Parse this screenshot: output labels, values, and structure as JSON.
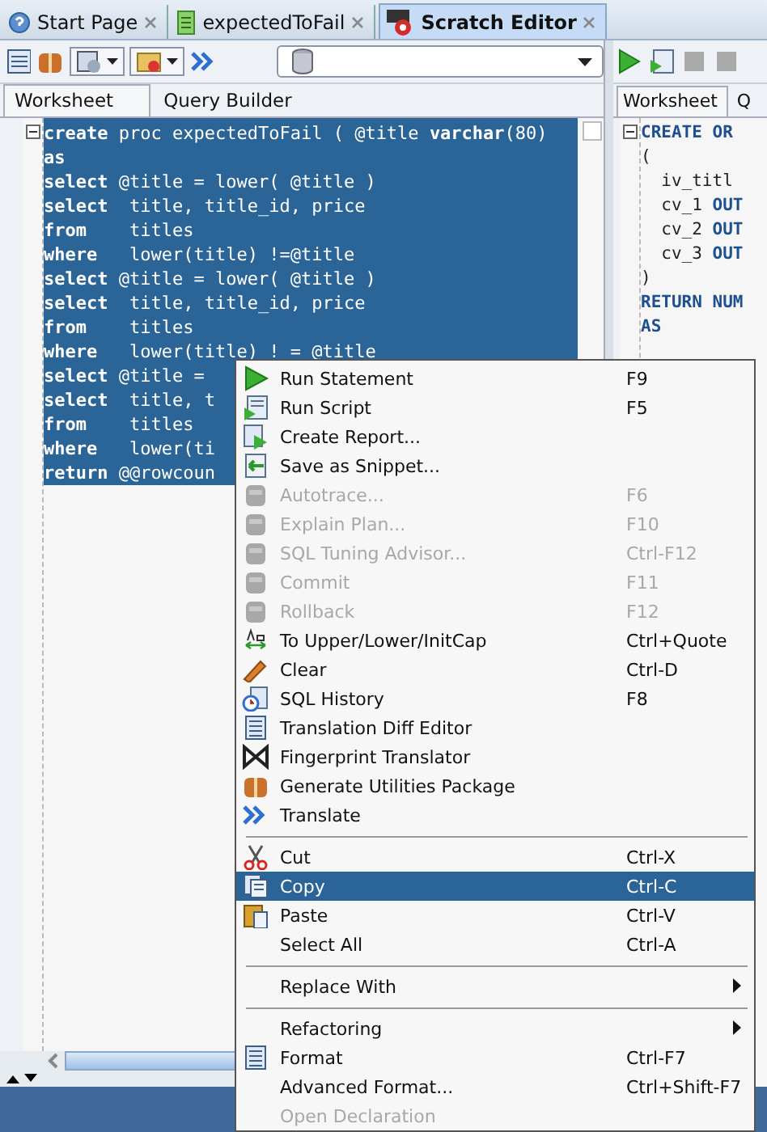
{
  "tabs": [
    {
      "label": "Start Page",
      "selected": false
    },
    {
      "label": "expectedToFail",
      "selected": false
    },
    {
      "label": "Scratch Editor",
      "selected": true
    }
  ],
  "left_pane": {
    "subtabs": [
      {
        "label": "Worksheet",
        "selected": true
      },
      {
        "label": "Query Builder",
        "selected": false
      }
    ],
    "selected": true,
    "code_lines": [
      "**create** proc expectedToFail ( @title **varchar**(80)",
      "**as**",
      "**select** @title = lower( @title )",
      "**select**  title, title_id, price",
      "**from**    titles",
      "**where**   lower(title) !=@title",
      "**select** @title = lower( @title )",
      "**select**  title, title_id, price",
      "**from**    titles",
      "**where**   lower(title) ! = @title",
      "**select** @title = ",
      "**select**  title, t",
      "**from**    titles",
      "**where**   lower(ti",
      "**return** @@rowcoun"
    ]
  },
  "right_pane": {
    "subtabs": [
      {
        "label": "Worksheet",
        "selected": true
      },
      {
        "label": "Q",
        "selected": false
      }
    ],
    "code_lines": [
      "**CREATE OR**",
      "(",
      "  iv_titl",
      "  cv_1 **OUT**",
      "  cv_2 **OUT**",
      "  cv_3 **OUT**",
      ")",
      "**RETURN NUM**",
      "**AS**"
    ]
  },
  "context_menu": {
    "items": [
      {
        "kind": "item",
        "label": "Run Statement",
        "shortcut": "F9",
        "disabled": false,
        "selected": false,
        "submenu": false
      },
      {
        "kind": "item",
        "label": "Run Script",
        "shortcut": "F5",
        "disabled": false,
        "selected": false,
        "submenu": false
      },
      {
        "kind": "item",
        "label": "Create Report...",
        "disabled": false,
        "selected": false,
        "submenu": false
      },
      {
        "kind": "item",
        "label": "Save as Snippet...",
        "disabled": false,
        "selected": false,
        "submenu": false
      },
      {
        "kind": "item",
        "label": "Autotrace...",
        "shortcut": "F6",
        "disabled": true,
        "selected": false,
        "submenu": false
      },
      {
        "kind": "item",
        "label": "Explain Plan...",
        "shortcut": "F10",
        "disabled": true,
        "selected": false,
        "submenu": false
      },
      {
        "kind": "item",
        "label": "SQL Tuning Advisor...",
        "shortcut": "Ctrl-F12",
        "disabled": true,
        "selected": false,
        "submenu": false
      },
      {
        "kind": "item",
        "label": "Commit",
        "shortcut": "F11",
        "disabled": true,
        "selected": false,
        "submenu": false
      },
      {
        "kind": "item",
        "label": "Rollback",
        "shortcut": "F12",
        "disabled": true,
        "selected": false,
        "submenu": false
      },
      {
        "kind": "item",
        "label": "To Upper/Lower/InitCap",
        "shortcut": "Ctrl+Quote",
        "disabled": false,
        "selected": false,
        "submenu": false
      },
      {
        "kind": "item",
        "label": "Clear",
        "shortcut": "Ctrl-D",
        "disabled": false,
        "selected": false,
        "submenu": false
      },
      {
        "kind": "item",
        "label": "SQL History",
        "shortcut": "F8",
        "disabled": false,
        "selected": false,
        "submenu": false
      },
      {
        "kind": "item",
        "label": "Translation Diff Editor",
        "disabled": false,
        "selected": false,
        "submenu": false
      },
      {
        "kind": "item",
        "label": "Fingerprint Translator",
        "disabled": false,
        "selected": false,
        "submenu": false
      },
      {
        "kind": "item",
        "label": "Generate Utilities Package",
        "disabled": false,
        "selected": false,
        "submenu": false
      },
      {
        "kind": "item",
        "label": "Translate",
        "disabled": false,
        "selected": false,
        "submenu": false
      },
      {
        "kind": "separator"
      },
      {
        "kind": "item",
        "label": "Cut",
        "shortcut": "Ctrl-X",
        "disabled": false,
        "selected": false,
        "submenu": false
      },
      {
        "kind": "item",
        "label": "Copy",
        "shortcut": "Ctrl-C",
        "disabled": false,
        "selected": true,
        "submenu": false
      },
      {
        "kind": "item",
        "label": "Paste",
        "shortcut": "Ctrl-V",
        "disabled": false,
        "selected": false,
        "submenu": false
      },
      {
        "kind": "item",
        "label": "Select All",
        "shortcut": "Ctrl-A",
        "disabled": false,
        "selected": false,
        "submenu": false
      },
      {
        "kind": "separator"
      },
      {
        "kind": "item",
        "label": "Replace With",
        "disabled": false,
        "selected": false,
        "submenu": true
      },
      {
        "kind": "separator"
      },
      {
        "kind": "item",
        "label": "Refactoring",
        "disabled": false,
        "selected": false,
        "submenu": true
      },
      {
        "kind": "item",
        "label": "Format",
        "shortcut": "Ctrl-F7",
        "disabled": false,
        "selected": false,
        "submenu": false
      },
      {
        "kind": "item",
        "label": "Advanced Format...",
        "shortcut": "Ctrl+Shift-F7",
        "disabled": false,
        "selected": false,
        "submenu": false
      },
      {
        "kind": "item",
        "label": "Open Declaration",
        "disabled": true,
        "selected": false,
        "submenu": false
      }
    ]
  }
}
